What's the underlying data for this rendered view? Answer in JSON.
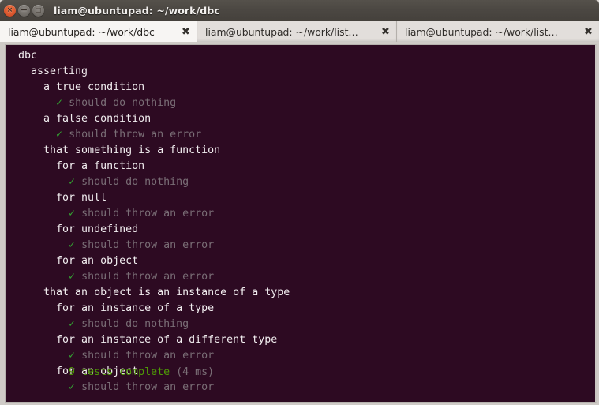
{
  "window": {
    "title": "liam@ubuntupad: ~/work/dbc",
    "controls": [
      {
        "name": "close",
        "glyph": "×"
      },
      {
        "name": "minimize",
        "glyph": "−"
      },
      {
        "name": "maximize",
        "glyph": "□"
      }
    ]
  },
  "tabs": [
    {
      "label": "liam@ubuntupad: ~/work/dbc",
      "active": true,
      "close_glyph": "✖"
    },
    {
      "label": "liam@ubuntupad: ~/work/list…",
      "active": false,
      "close_glyph": "✖"
    },
    {
      "label": "liam@ubuntupad: ~/work/list…",
      "active": false,
      "close_glyph": "✖"
    }
  ],
  "terminal": {
    "background_color": "#2d0a22",
    "suite_color": "#f2eef0",
    "pass_color": "#7a6e76",
    "check_color": "#33a532",
    "summary_color": "#4e9a06",
    "check_glyph": "✓",
    "lines": [
      {
        "indent": 0,
        "type": "suite",
        "text": "dbc"
      },
      {
        "indent": 1,
        "type": "suite",
        "text": "asserting"
      },
      {
        "indent": 2,
        "type": "suite",
        "text": "a true condition"
      },
      {
        "indent": 3,
        "type": "pass",
        "text": "should do nothing"
      },
      {
        "indent": 2,
        "type": "suite",
        "text": "a false condition"
      },
      {
        "indent": 3,
        "type": "pass",
        "text": "should throw an error"
      },
      {
        "indent": 2,
        "type": "suite",
        "text": "that something is a function"
      },
      {
        "indent": 3,
        "type": "suite",
        "text": "for a function"
      },
      {
        "indent": 4,
        "type": "pass",
        "text": "should do nothing"
      },
      {
        "indent": 3,
        "type": "suite",
        "text": "for null"
      },
      {
        "indent": 4,
        "type": "pass",
        "text": "should throw an error"
      },
      {
        "indent": 3,
        "type": "suite",
        "text": "for undefined"
      },
      {
        "indent": 4,
        "type": "pass",
        "text": "should throw an error"
      },
      {
        "indent": 3,
        "type": "suite",
        "text": "for an object"
      },
      {
        "indent": 4,
        "type": "pass",
        "text": "should throw an error"
      },
      {
        "indent": 2,
        "type": "suite",
        "text": "that an object is an instance of a type"
      },
      {
        "indent": 3,
        "type": "suite",
        "text": "for an instance of a type"
      },
      {
        "indent": 4,
        "type": "pass",
        "text": "should do nothing"
      },
      {
        "indent": 3,
        "type": "suite",
        "text": "for an instance of a different type"
      },
      {
        "indent": 4,
        "type": "pass",
        "text": "should throw an error"
      },
      {
        "indent": 3,
        "type": "suite",
        "text": "for an object"
      },
      {
        "indent": 4,
        "type": "pass",
        "text": "should throw an error"
      }
    ],
    "summary": {
      "count_text": "9 tests complete",
      "duration_text": "(4 ms)"
    }
  }
}
